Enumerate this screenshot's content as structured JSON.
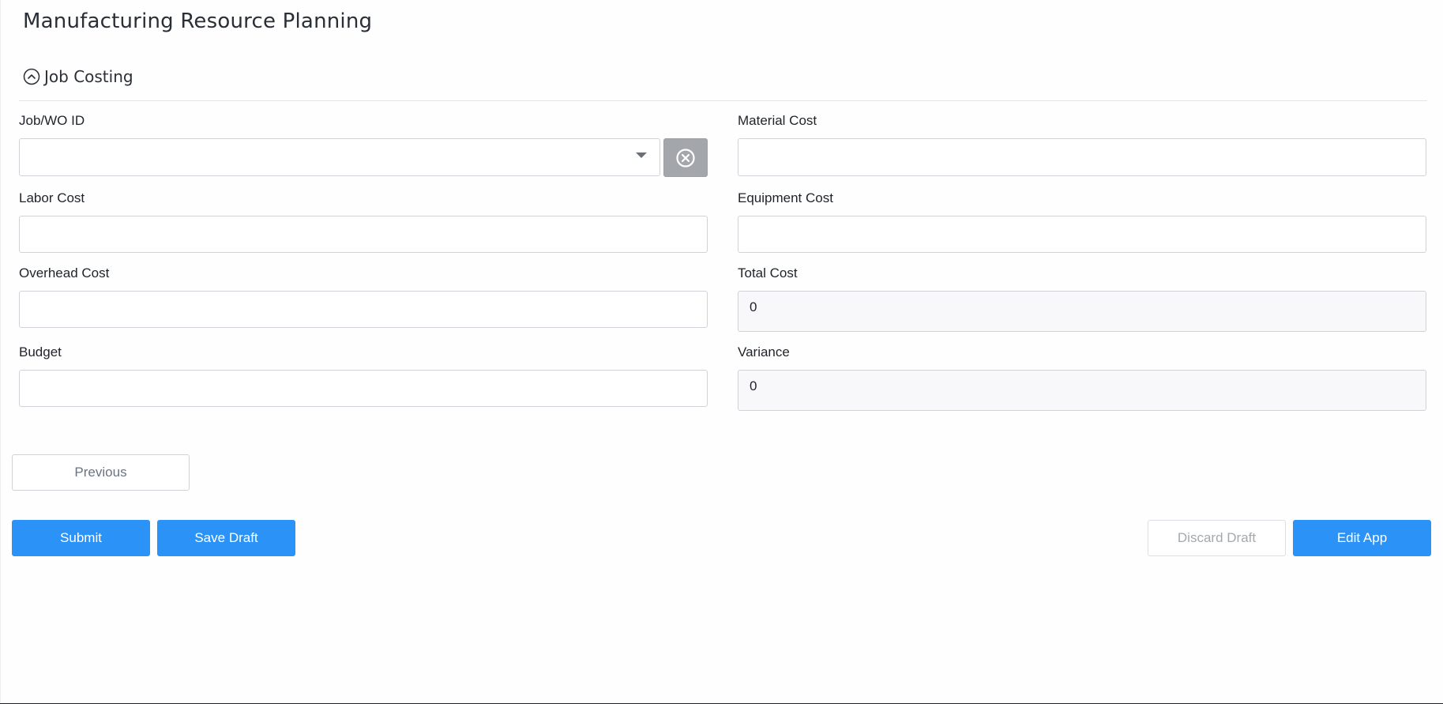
{
  "app": {
    "title": "Manufacturing Resource Planning"
  },
  "section": {
    "title": "Job Costing",
    "icon": "chevron-up-circle-icon",
    "expanded": true
  },
  "fields": {
    "job_wo_id": {
      "label": "Job/WO ID",
      "value": "",
      "clear_icon": "close-circle-icon"
    },
    "material_cost": {
      "label": "Material Cost",
      "value": ""
    },
    "labor_cost": {
      "label": "Labor Cost",
      "value": ""
    },
    "equipment_cost": {
      "label": "Equipment Cost",
      "value": ""
    },
    "overhead_cost": {
      "label": "Overhead Cost",
      "value": ""
    },
    "total_cost": {
      "label": "Total Cost",
      "value": "0"
    },
    "budget": {
      "label": "Budget",
      "value": ""
    },
    "variance": {
      "label": "Variance",
      "value": "0"
    }
  },
  "buttons": {
    "previous": "Previous",
    "submit": "Submit",
    "save_draft": "Save Draft",
    "discard_draft": "Discard Draft",
    "edit_app": "Edit App"
  },
  "colors": {
    "primary": "#2b93f7",
    "clear_button": "#a3a6ab",
    "readonly_bg": "#f8f7fa"
  }
}
